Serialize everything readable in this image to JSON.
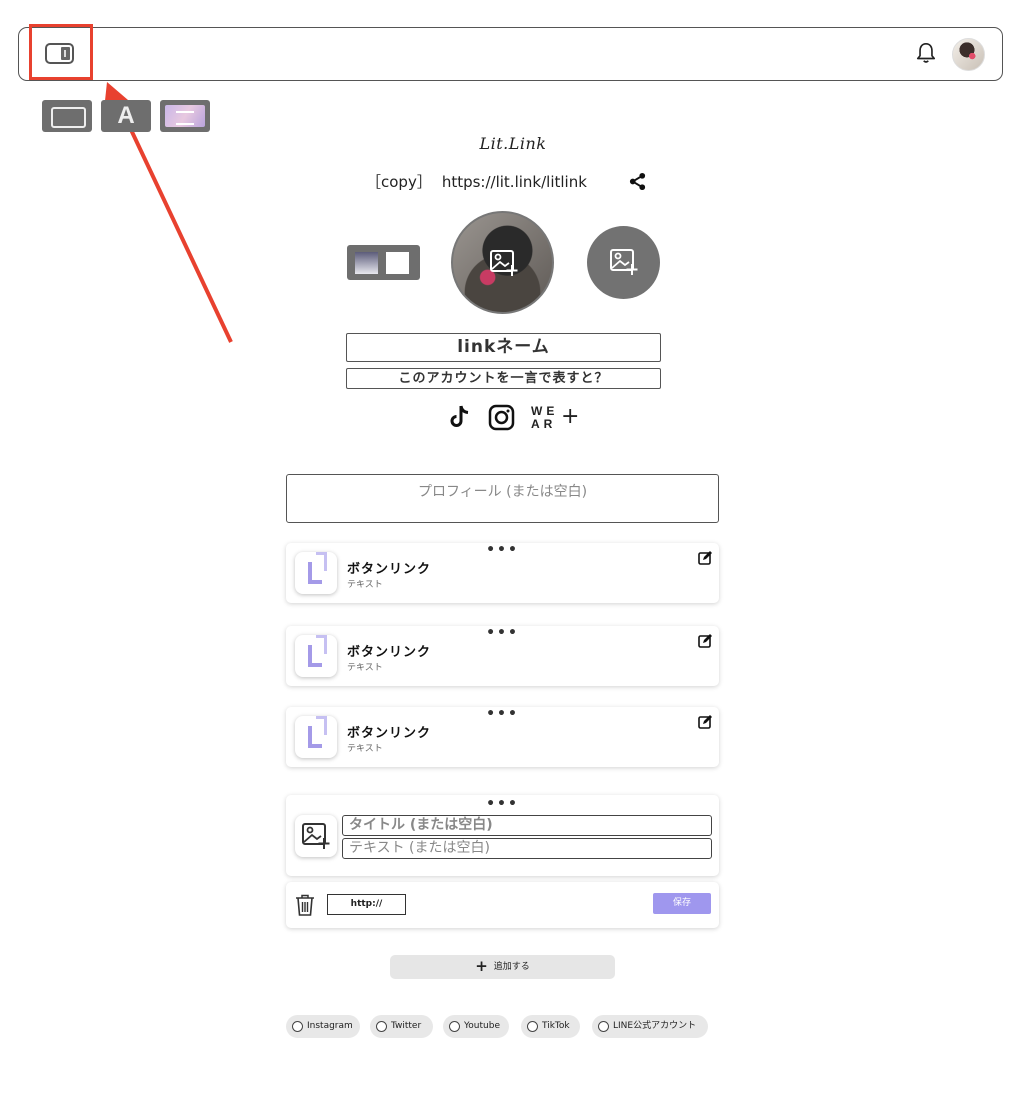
{
  "header": {
    "sidebar_toggle_icon": "sidebar-toggle-icon",
    "bell_icon": "bell-icon",
    "avatar": "user-avatar"
  },
  "annotation": {
    "highlight_color": "#e8412f"
  },
  "toolbar": {
    "layout_icon": "layout-icon",
    "font_label": "A",
    "background_icon": "background-image-icon"
  },
  "profile": {
    "logo": "Lit.Link",
    "copy_label": "［copy］",
    "url": "https://lit.link/litlink",
    "share_icon": "share-icon",
    "link_name": "linkネーム",
    "bio_prompt": "このアカウントを一言で表すと？",
    "profile_placeholder": "プロフィール (または空白)"
  },
  "social": {
    "icons": [
      "tiktok-icon",
      "instagram-icon",
      "wear-icon",
      "plus-icon"
    ],
    "wear_label": "WE AR",
    "add_label": "+"
  },
  "links": [
    {
      "title": "ボタンリンク",
      "subtitle": "テキスト",
      "dots": "•••"
    },
    {
      "title": "ボタンリンク",
      "subtitle": "テキスト",
      "dots": "•••"
    },
    {
      "title": "ボタンリンク",
      "subtitle": "テキスト",
      "dots": "•••"
    }
  ],
  "editor": {
    "dots": "•••",
    "title_placeholder": "タイトル (または空白)",
    "text_placeholder": "テキスト (または空白)",
    "url_value": "http://",
    "save_label": "保存"
  },
  "add_button": {
    "plus": "+",
    "label": "追加する"
  },
  "chips": [
    "Instagram",
    "Twitter",
    "Youtube",
    "TikTok",
    "LINE公式アカウント"
  ],
  "colors": {
    "accent": "#9f97ee",
    "dark_button": "#6e6e6e"
  }
}
